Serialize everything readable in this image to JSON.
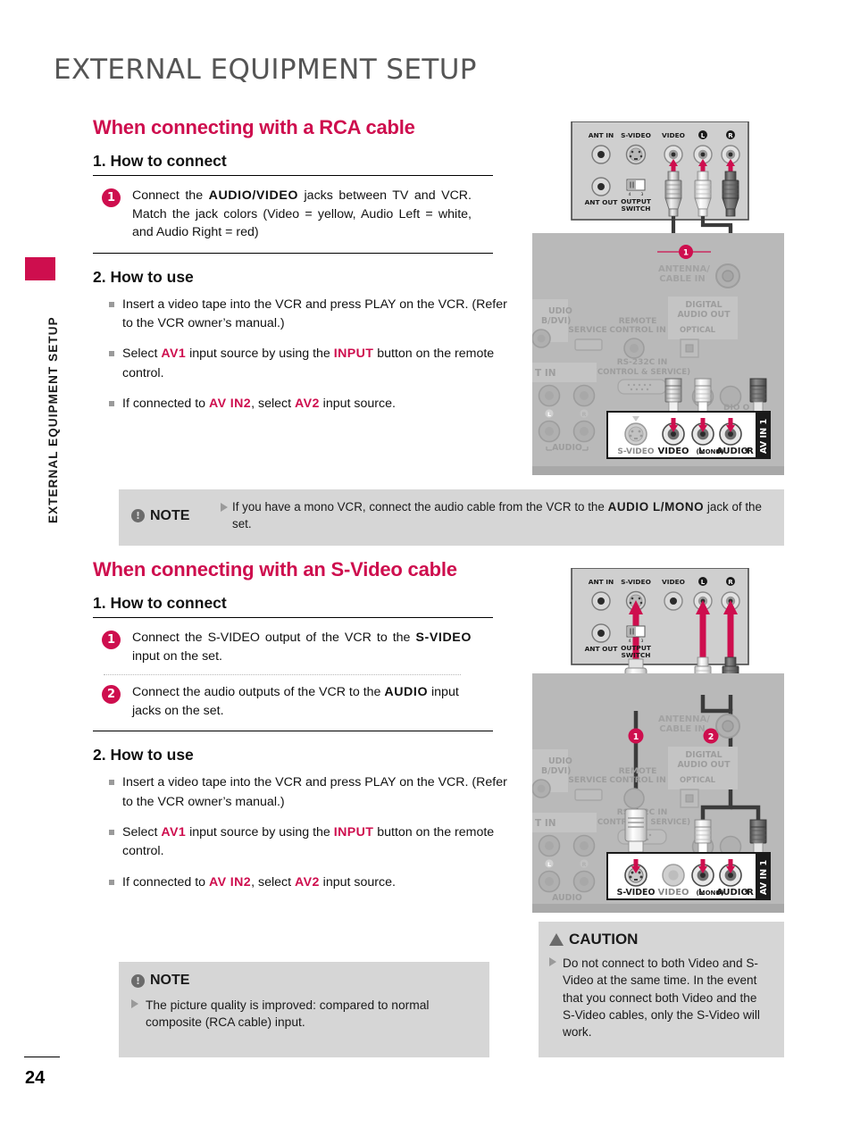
{
  "page": {
    "title": "EXTERNAL EQUIPMENT SETUP",
    "sidebar_label": "EXTERNAL EQUIPMENT SETUP",
    "page_number": "24",
    "accent_color": "#CE0E4E",
    "note_bg_color": "#D6D6D6"
  },
  "sections": [
    {
      "heading": "When connecting with a RCA cable",
      "connect_heading": "1. How to connect",
      "steps": [
        {
          "num": "1",
          "parts": [
            {
              "t": "Connect the ",
              "s": "plain"
            },
            {
              "t": "AUDIO/VIDEO",
              "s": "bold"
            },
            {
              "t": " jacks between TV and VCR. Match the jack colors (Video = yellow, Audio Left = white, and Audio Right = red)",
              "s": "plain"
            }
          ]
        }
      ],
      "use_heading": "2. How to use",
      "bullets": [
        [
          {
            "t": "Insert a video tape into the VCR and press PLAY on the VCR. (Refer to the VCR owner’s manual.)",
            "s": "plain"
          }
        ],
        [
          {
            "t": "Select ",
            "s": "plain"
          },
          {
            "t": "AV1",
            "s": "pink"
          },
          {
            "t": " input source by using the ",
            "s": "plain"
          },
          {
            "t": "INPUT",
            "s": "pink"
          },
          {
            "t": " button on the remote control.",
            "s": "plain"
          }
        ],
        [
          {
            "t": "If connected to ",
            "s": "plain"
          },
          {
            "t": "AV IN2",
            "s": "pink"
          },
          {
            "t": ", select ",
            "s": "plain"
          },
          {
            "t": "AV2",
            "s": "pink"
          },
          {
            "t": " input source.",
            "s": "plain"
          }
        ]
      ]
    },
    {
      "heading": "When connecting with an S-Video cable",
      "connect_heading": "1. How to connect",
      "steps": [
        {
          "num": "1",
          "parts": [
            {
              "t": "Connect the S-VIDEO output of the VCR to the ",
              "s": "plain"
            },
            {
              "t": "S-VIDEO",
              "s": "bold"
            },
            {
              "t": " input on the set.",
              "s": "plain"
            }
          ]
        },
        {
          "num": "2",
          "parts": [
            {
              "t": "Connect the audio outputs of the VCR to the ",
              "s": "plain"
            },
            {
              "t": "AUDIO",
              "s": "bold"
            },
            {
              "t": " input jacks on the set.",
              "s": "plain"
            }
          ]
        }
      ],
      "use_heading": "2. How to use",
      "bullets": [
        [
          {
            "t": "Insert a video tape into the VCR and press PLAY on the VCR. (Refer to the VCR owner’s manual.)",
            "s": "plain"
          }
        ],
        [
          {
            "t": "Select ",
            "s": "plain"
          },
          {
            "t": "AV1",
            "s": "pink"
          },
          {
            "t": " input source by using the ",
            "s": "plain"
          },
          {
            "t": "INPUT",
            "s": "pink"
          },
          {
            "t": " button on the remote control.",
            "s": "plain"
          }
        ],
        [
          {
            "t": "If connected to ",
            "s": "plain"
          },
          {
            "t": "AV IN2",
            "s": "pink"
          },
          {
            "t": ", select ",
            "s": "plain"
          },
          {
            "t": "AV2",
            "s": "pink"
          },
          {
            "t": " input source.",
            "s": "plain"
          }
        ]
      ]
    }
  ],
  "note_top": {
    "label": "NOTE",
    "icon": "exclamation-circle-icon",
    "parts": [
      {
        "t": "If you have a mono VCR, connect the audio cable from the VCR to the ",
        "s": "plain"
      },
      {
        "t": "AUDIO L/MONO",
        "s": "bold"
      },
      {
        "t": " jack of the set.",
        "s": "plain"
      }
    ]
  },
  "note_bottom": {
    "label": "NOTE",
    "icon": "exclamation-circle-icon",
    "body": "The picture quality is improved: compared to normal composite (RCA cable) input."
  },
  "caution": {
    "label": "CAUTION",
    "icon": "warning-triangle-icon",
    "body": "Do not connect to both Video and S-Video at the same time. In the event that you connect both Video and the S-Video cables, only the S-Video will work."
  },
  "diagram_rca": {
    "vcr_panel": {
      "labels_top": [
        "ANT IN",
        "S-VIDEO",
        "VIDEO",
        "L",
        "R"
      ],
      "labels_bottom": [
        "ANT OUT",
        "OUTPUT SWITCH"
      ],
      "switch_positions": [
        "4",
        "3"
      ]
    },
    "tv_panel": {
      "labels": [
        "AUDIO (RGB/DVI)",
        "SERVICE",
        "REMOTE CONTROL IN",
        "ANTENNA/ CABLE IN",
        "DIGITAL AUDIO OUT",
        "OPTICAL",
        "RS-232C IN",
        "(CONTROL & SERVICE)",
        "COMPONENT IN",
        "AUDIO"
      ],
      "av_block": {
        "title": "AV IN 1",
        "jacks": [
          "S-VIDEO",
          "VIDEO",
          "L(MONO)",
          "AUDIO",
          "R"
        ],
        "audio_label": "L(MONO)-AUDIO-R"
      }
    },
    "callouts": [
      "1"
    ]
  },
  "diagram_svideo": {
    "vcr_panel": {
      "labels_top": [
        "ANT IN",
        "S-VIDEO",
        "VIDEO",
        "L",
        "R"
      ],
      "labels_bottom": [
        "ANT OUT",
        "OUTPUT SWITCH"
      ],
      "switch_positions": [
        "4",
        "3"
      ]
    },
    "tv_panel": {
      "labels": [
        "AUDIO (RGB/DVI)",
        "SERVICE",
        "REMOTE CONTROL IN",
        "ANTENNA/ CABLE IN",
        "DIGITAL AUDIO OUT",
        "OPTICAL",
        "RS-232C IN",
        "(CONTROL & SERVICE)",
        "COMPONENT IN",
        "AUDIO"
      ],
      "av_block": {
        "title": "AV IN 1",
        "jacks": [
          "S-VIDEO",
          "VIDEO",
          "L(MONO)",
          "AUDIO",
          "R"
        ],
        "audio_label": "L(MONO)-AUDIO-R"
      }
    },
    "callouts": [
      "1",
      "2"
    ]
  }
}
